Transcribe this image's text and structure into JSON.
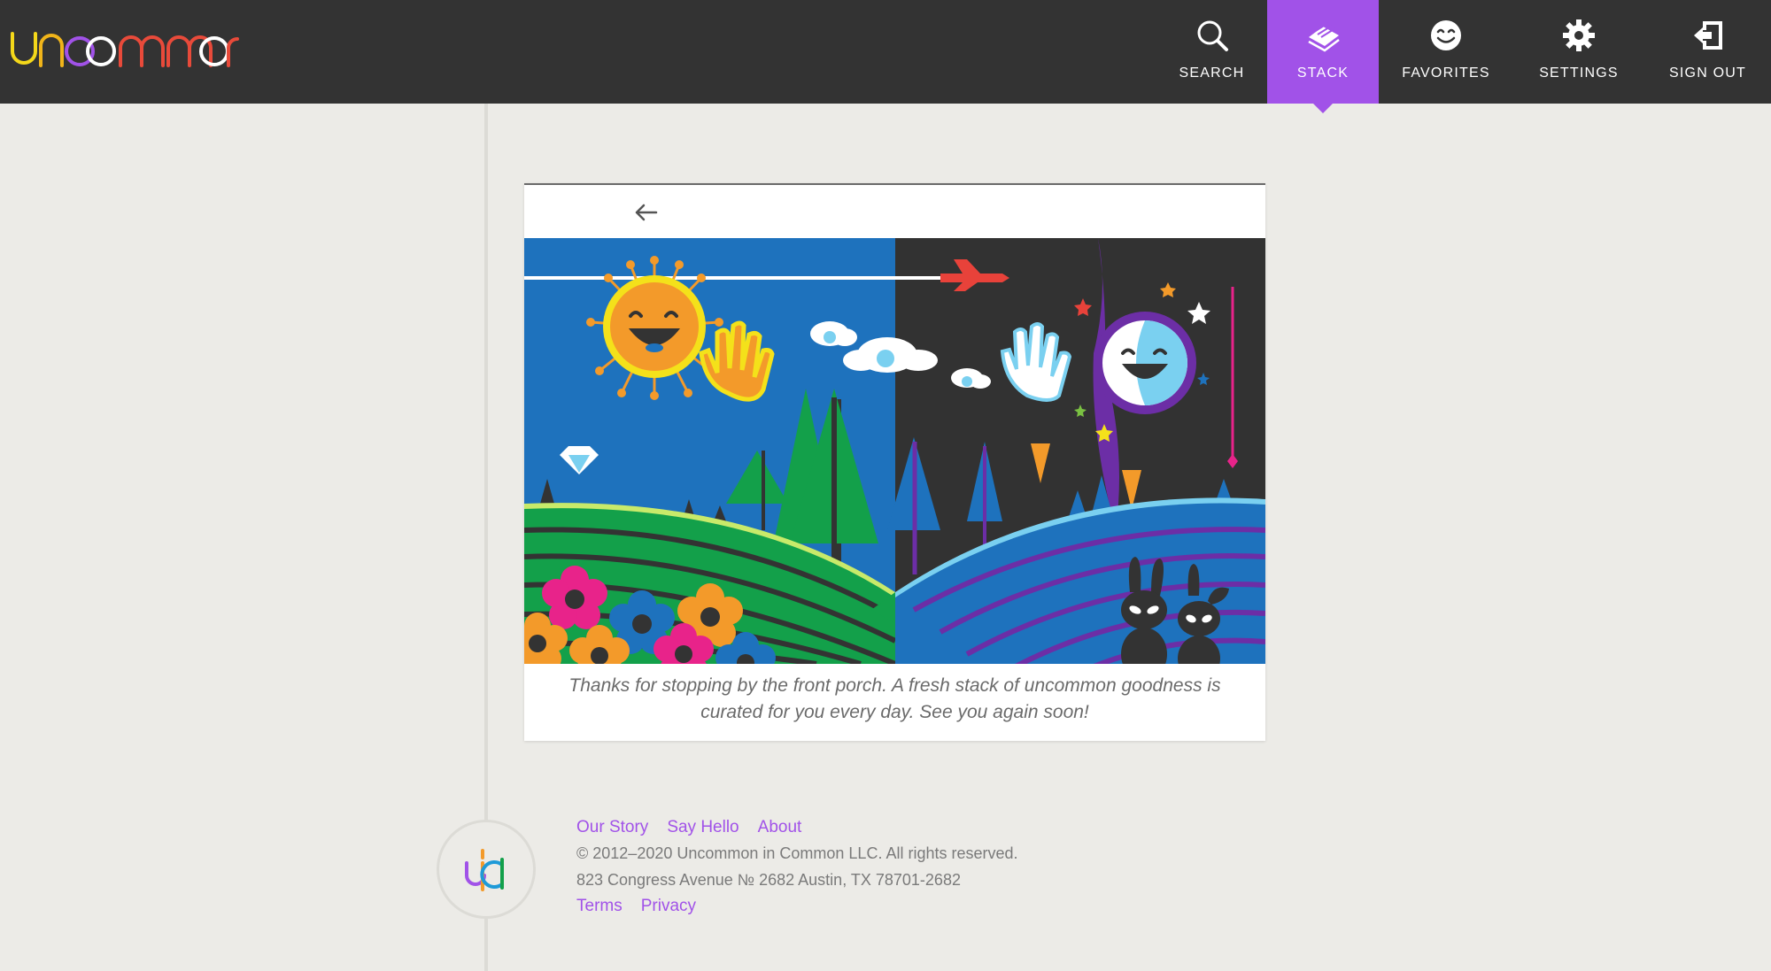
{
  "header": {
    "logo_text": "uncommon",
    "nav": [
      {
        "label": "SEARCH",
        "icon": "search-icon"
      },
      {
        "label": "STACK",
        "icon": "stack-icon",
        "active": true
      },
      {
        "label": "FAVORITES",
        "icon": "smile-icon"
      },
      {
        "label": "SETTINGS",
        "icon": "gear-icon"
      },
      {
        "label": "SIGN OUT",
        "icon": "sign-out-icon"
      }
    ]
  },
  "card": {
    "back_icon": "back-arrow-icon",
    "illustration": "day-night-illustration",
    "message": "Thanks for stopping by the front porch. A fresh stack of uncommon goodness is curated for you every day. See you again soon!"
  },
  "footer": {
    "links": [
      "Our Story",
      "Say Hello",
      "About"
    ],
    "copyright": "© 2012–2020 Uncommon in Common LLC. All rights reserved.",
    "address": "823 Congress Avenue № 2682 Austin, TX 78701-2682",
    "legal": [
      "Terms",
      "Privacy"
    ]
  },
  "colors": {
    "header_bg": "#333333",
    "accent": "#a152e8",
    "page_bg": "#ecebe7",
    "text_muted": "#6a6a6a"
  }
}
